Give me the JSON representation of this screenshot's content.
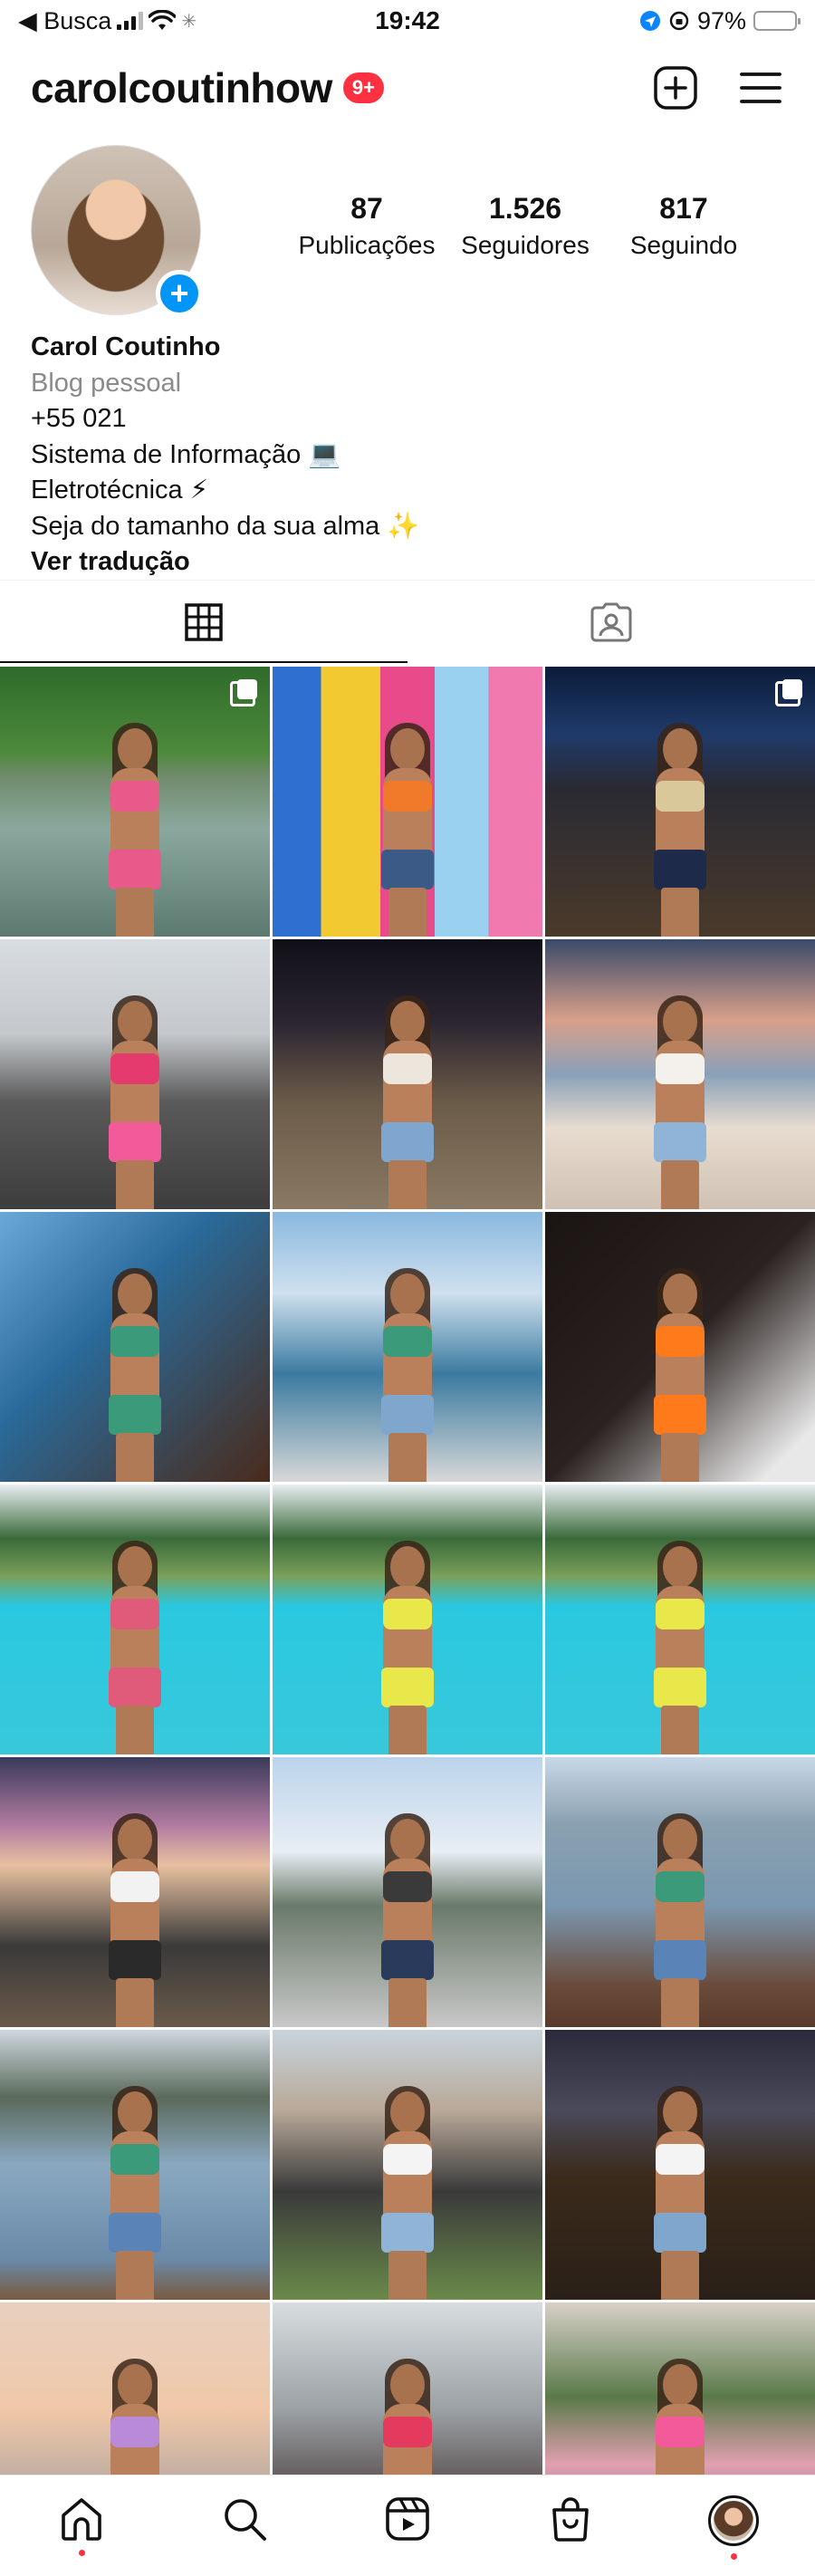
{
  "status_bar": {
    "back_label": "◀ Busca",
    "time": "19:42",
    "battery_percent": "97%",
    "battery_level": 0.97
  },
  "header": {
    "username": "carolcoutinhow",
    "notification_badge": "9+",
    "icons": [
      "plus-square-icon",
      "menu-icon"
    ],
    "badge_color": "#ff3040"
  },
  "profile": {
    "stats": [
      {
        "value": "87",
        "label": "Publicações"
      },
      {
        "value": "1.526",
        "label": "Seguidores"
      },
      {
        "value": "817",
        "label": "Seguindo"
      }
    ],
    "name": "Carol Coutinho",
    "category": "Blog pessoal",
    "bio_lines": [
      "+55 021",
      "Sistema de Informação 💻",
      "Eletrotécnica ⚡",
      "Seja do tamanho da sua alma ✨"
    ],
    "translate_label": "Ver tradução",
    "accent_color": "#0095f6"
  },
  "tabs": [
    {
      "name": "grid",
      "icon": "grid-icon",
      "active": true
    },
    {
      "name": "tagged",
      "icon": "tagged-person-icon",
      "active": false
    }
  ],
  "posts": [
    {
      "scene": "river",
      "multi": true,
      "top": "#e85a8a",
      "bottom": "#e85a8a"
    },
    {
      "scene": "colorful-wall",
      "multi": false,
      "top": "#f07a2a",
      "bottom": "#3b5b86"
    },
    {
      "scene": "concert",
      "multi": true,
      "top": "#d9c89a",
      "bottom": "#1d2a4a"
    },
    {
      "scene": "arches-street",
      "multi": false,
      "top": "#e43a6e",
      "bottom": "#f25a9a"
    },
    {
      "scene": "night-beach",
      "multi": false,
      "top": "#ece6dc",
      "bottom": "#7ea6cf"
    },
    {
      "scene": "sunset-beach",
      "multi": false,
      "top": "#f4f0ec",
      "bottom": "#8fb4d8"
    },
    {
      "scene": "drink-closeup",
      "multi": false,
      "top": "#3a9a7a",
      "bottom": "#3a9a7a"
    },
    {
      "scene": "bridge-water",
      "multi": false,
      "top": "#3a9a7a",
      "bottom": "#7fa6cc"
    },
    {
      "scene": "selfie-night",
      "multi": false,
      "top": "#ff7a1a",
      "bottom": "#ff7a1a"
    },
    {
      "scene": "pool",
      "multi": false,
      "top": "#e05a7a",
      "bottom": "#e05a7a"
    },
    {
      "scene": "pool",
      "multi": false,
      "top": "#e8e84a",
      "bottom": "#e8e84a"
    },
    {
      "scene": "pool",
      "multi": false,
      "top": "#e8e84a",
      "bottom": "#e8e84a"
    },
    {
      "scene": "dusk-pier",
      "multi": false,
      "top": "#f2f2f2",
      "bottom": "#2a2a2a"
    },
    {
      "scene": "bridge-parking",
      "multi": false,
      "top": "#3a3a3a",
      "bottom": "#2a3a5a"
    },
    {
      "scene": "lagoon",
      "multi": false,
      "top": "#3a9a7a",
      "bottom": "#5a84b8"
    },
    {
      "scene": "lagoon-mountain",
      "multi": false,
      "top": "#3a9a7a",
      "bottom": "#5a84b8"
    },
    {
      "scene": "city-view",
      "multi": false,
      "top": "#f4f4f4",
      "bottom": "#8fb4d8"
    },
    {
      "scene": "night-city",
      "multi": false,
      "top": "#f4f4f4",
      "bottom": "#7fa6cc"
    },
    {
      "scene": "bridge-sunset",
      "multi": false,
      "top": "#b98ad8",
      "bottom": "#b98ad8"
    },
    {
      "scene": "arches-carnival",
      "multi": false,
      "top": "#e43a5e",
      "bottom": "#e43a5e"
    },
    {
      "scene": "carnival-group",
      "multi": false,
      "top": "#f25a9a",
      "bottom": "#3a5a9a"
    }
  ],
  "bottom_nav": {
    "items": [
      "home-icon",
      "search-icon",
      "reels-icon",
      "shop-icon",
      "profile-avatar"
    ],
    "dots": [
      "home-icon",
      "profile-avatar"
    ]
  }
}
